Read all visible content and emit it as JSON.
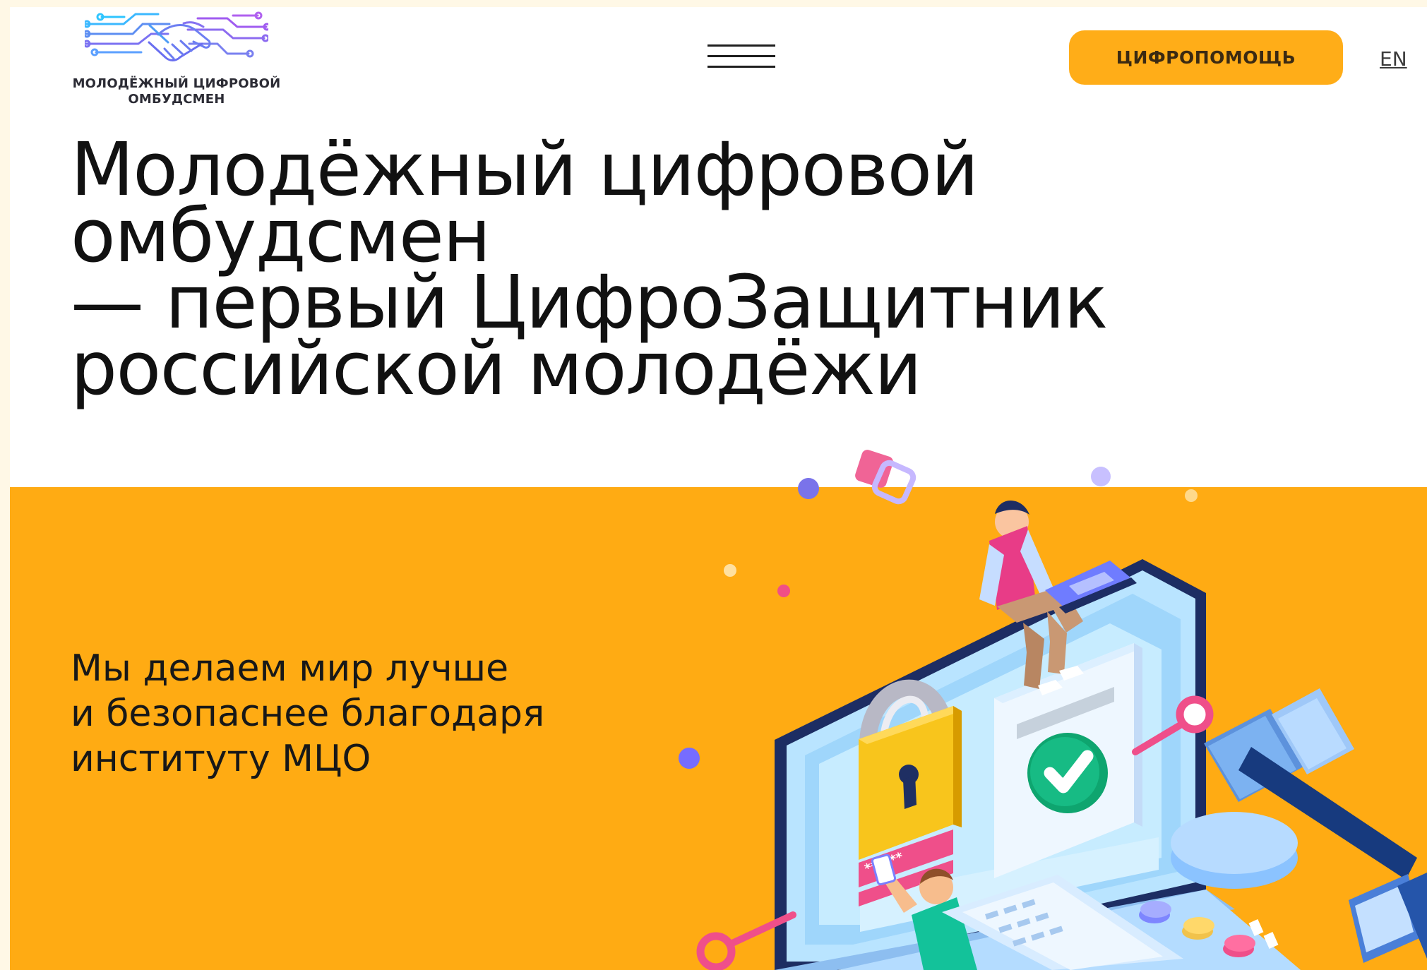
{
  "header": {
    "logo_line1": "МОЛОДЁЖНЫЙ ЦИФРОВОЙ",
    "logo_line2": "ОМБУДСМЕН",
    "help_button": "ЦИФРОПОМОЩЬ",
    "language": "EN"
  },
  "hero": {
    "title_line1": "Молодёжный цифровой омбудсмен",
    "title_line2": "— первый ЦифроЗащитник",
    "title_line3": "российской молодёжи",
    "subtitle_line1": "Мы делаем мир лучше",
    "subtitle_line2": "и безопаснее благодаря",
    "subtitle_line3": "институту МЦО",
    "password_mask": "******"
  },
  "colors": {
    "accent": "#ffab13",
    "button": "#ffad18",
    "text": "#111111",
    "outer_background": "#fff8e6"
  }
}
